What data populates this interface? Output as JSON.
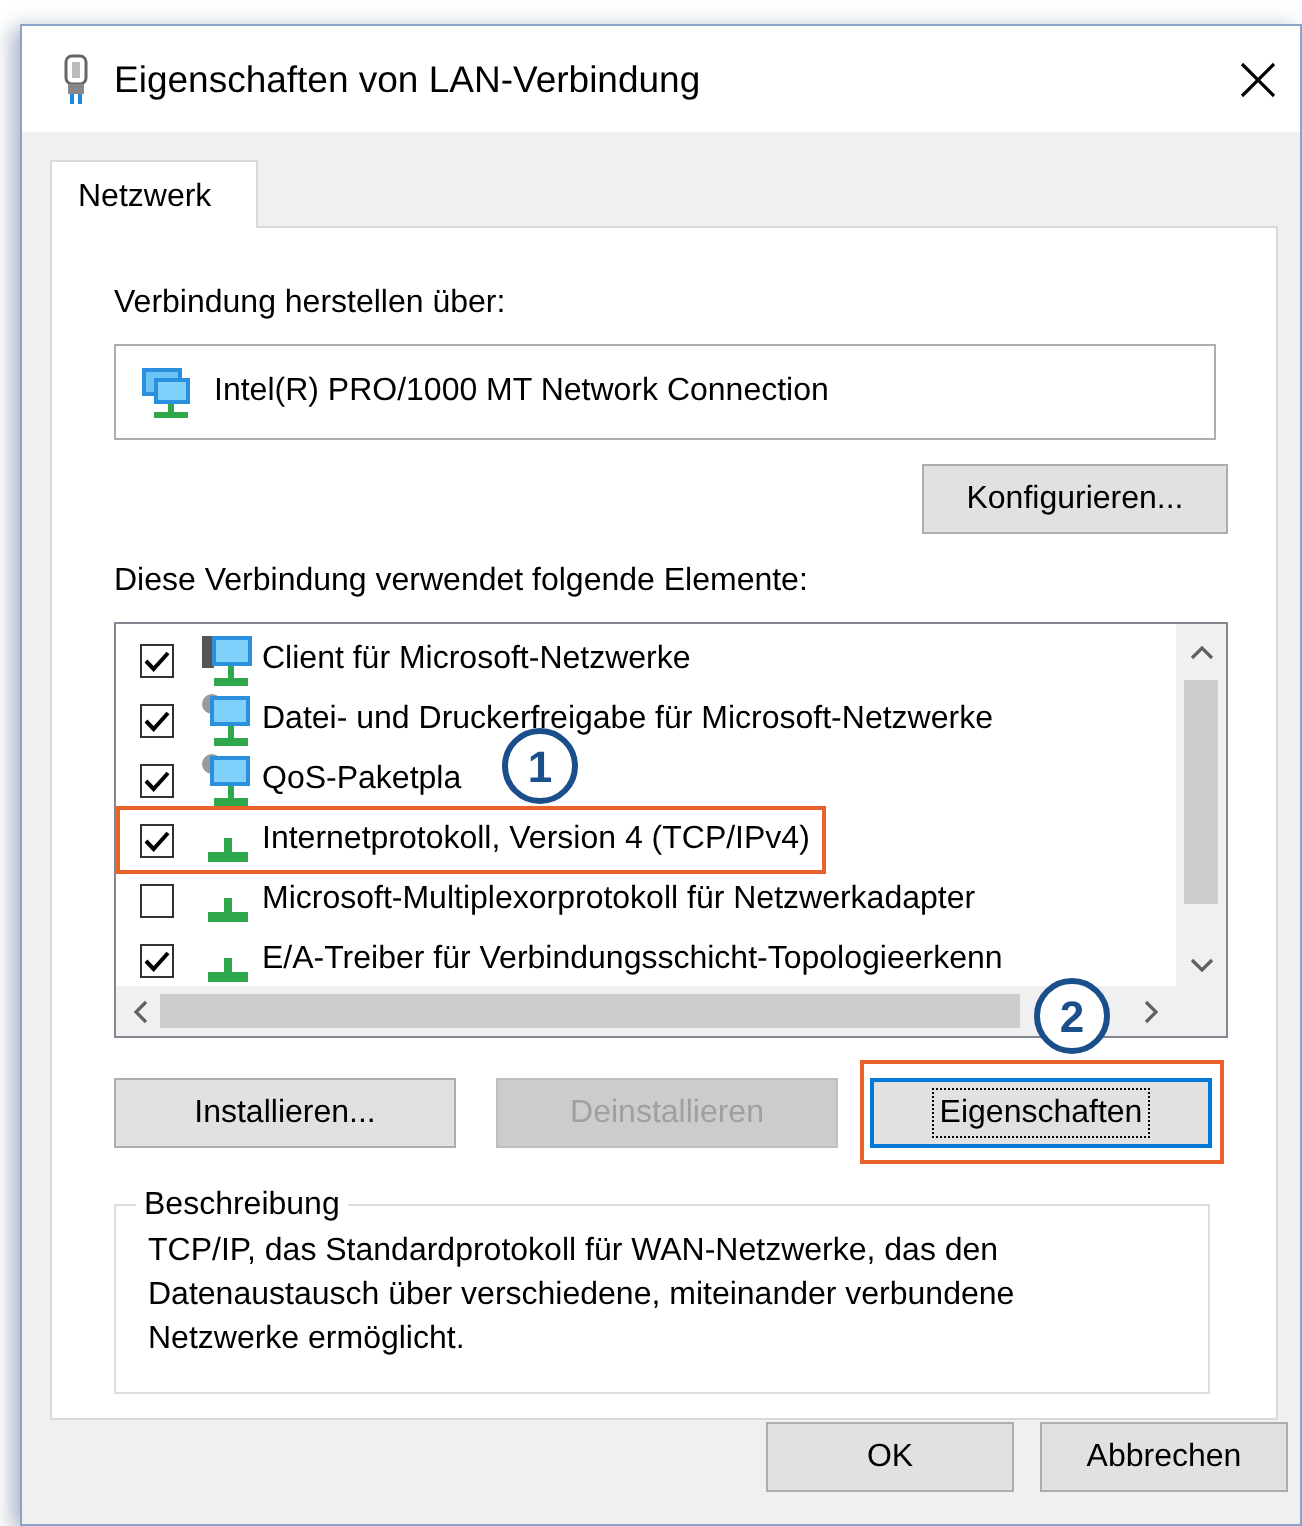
{
  "window": {
    "title": "Eigenschaften von LAN-Verbindung"
  },
  "tabs": [
    {
      "label": "Netzwerk",
      "selected": true
    }
  ],
  "connect_label": "Verbindung herstellen über:",
  "adapter": "Intel(R) PRO/1000 MT Network Connection",
  "configure_button": "Konfigurieren...",
  "elements_label": "Diese Verbindung verwendet folgende Elemente:",
  "elements": [
    {
      "label": "Client für Microsoft-Netzwerke",
      "checked": true,
      "kind": "client",
      "highlighted": false
    },
    {
      "label": "Datei- und Druckerfreigabe für Microsoft-Netzwerke",
      "checked": true,
      "kind": "service",
      "highlighted": false
    },
    {
      "label": "QoS-Paketpla",
      "checked": true,
      "kind": "service",
      "highlighted": false
    },
    {
      "label": "Internetprotokoll, Version 4 (TCP/IPv4)",
      "checked": true,
      "kind": "protocol",
      "highlighted": true
    },
    {
      "label": "Microsoft-Multiplexorprotokoll für Netzwerkadapter",
      "checked": false,
      "kind": "protocol",
      "highlighted": false
    },
    {
      "label": "E/A-Treiber für Verbindungsschicht-Topologieerkenn",
      "checked": true,
      "kind": "protocol",
      "highlighted": false
    }
  ],
  "element_buttons": [
    {
      "label": "Installieren...",
      "disabled": false,
      "focused": false,
      "highlighted": false
    },
    {
      "label": "Deinstallieren",
      "disabled": true,
      "focused": false,
      "highlighted": false
    },
    {
      "label": "Eigenschaften",
      "disabled": false,
      "focused": true,
      "highlighted": true
    }
  ],
  "description": {
    "title": "Beschreibung",
    "text": "TCP/IP, das Standardprotokoll für WAN-Netzwerke, das den Datenaustausch über verschiedene, miteinander verbundene Netzwerke ermöglicht."
  },
  "dialog_buttons": [
    "OK",
    "Abbrechen"
  ],
  "callouts": [
    "1",
    "2"
  ]
}
